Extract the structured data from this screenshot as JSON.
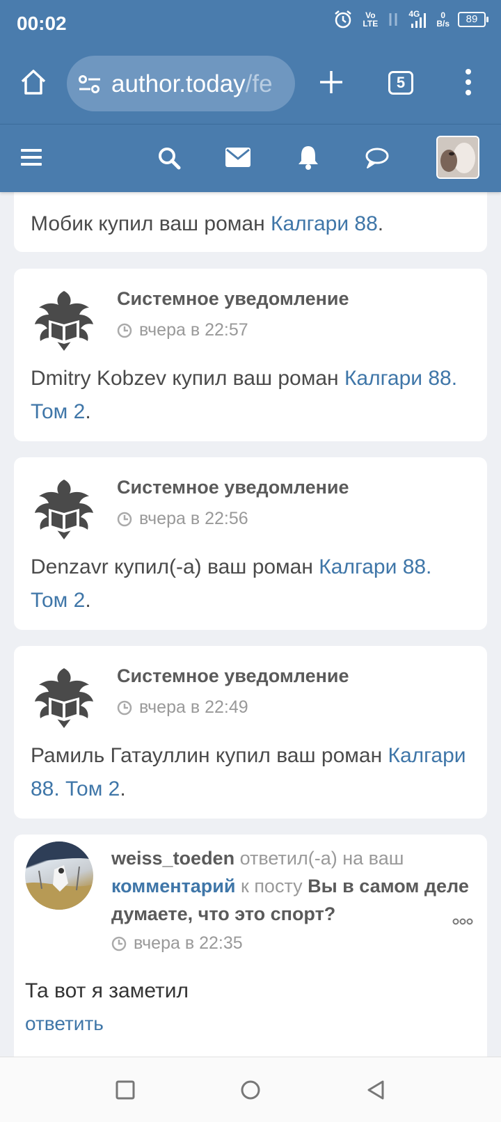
{
  "status_bar": {
    "time": "00:02",
    "vo_lte": "Vo\nLTE",
    "network": "4G",
    "data_rate_top": "0",
    "data_rate_bottom": "B/s",
    "battery": "89"
  },
  "browser": {
    "url_main": "author.today",
    "url_rest": "/fe",
    "tab_count": "5"
  },
  "notifications": [
    {
      "text": "Мобик купил ваш роман ",
      "link": "Калгари 88",
      "tail": "."
    },
    {
      "title": "Системное уведомление",
      "time": "вчера в 22:57",
      "text": "Dmitry Kobzev купил ваш роман ",
      "link": "Калгари 88. Том 2",
      "tail": "."
    },
    {
      "title": "Системное уведомление",
      "time": "вчера в 22:56",
      "text": "Denzavr купил(-а) ваш роман ",
      "link": "Калгари 88. Том 2",
      "tail": "."
    },
    {
      "title": "Системное уведомление",
      "time": "вчера в 22:49",
      "text": "Рамиль Гатауллин купил ваш роман ",
      "link": "Калгари 88. Том 2",
      "tail": "."
    }
  ],
  "reply_card": {
    "username": "weiss_toeden",
    "action": " ответил(-а) на ваш ",
    "comment_link": "комментарий",
    "to_post": " к посту ",
    "post_title": "Вы в самом деле думаете, что это спорт?",
    "time": "вчера в 22:35",
    "comment": "Та вот я заметил",
    "reply_link": "ответить"
  },
  "colors": {
    "header_blue": "#4a7cad",
    "link_blue": "#3f76a8",
    "background": "#eef0f4"
  }
}
